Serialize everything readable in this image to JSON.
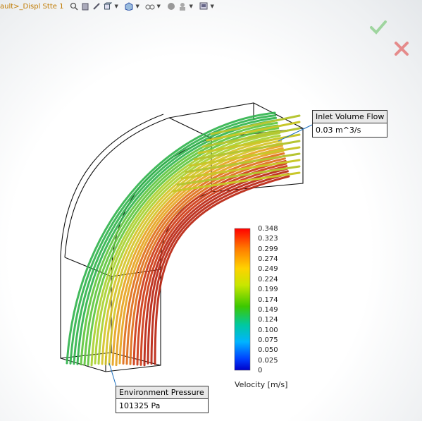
{
  "toolbar": {
    "config_label": "ault>_Displ",
    "config_label_tail": "Stte 1",
    "icons": [
      "search-icon",
      "part-icon",
      "edit-icon",
      "view-orientation-icon",
      "display-style-icon",
      "hide-show-icon",
      "appearance-icon",
      "scene-icon",
      "view-settings-icon"
    ]
  },
  "confirm": {
    "accept_icon": "checkmark-icon",
    "cancel_icon": "close-icon",
    "accept_color": "#8fcf8f",
    "cancel_color": "#e07a7a"
  },
  "callouts": {
    "inlet": {
      "title": "Inlet Volume Flow",
      "value": "0.03 m^3/s"
    },
    "outlet": {
      "title": "Environment Pressure",
      "value": "101325 Pa"
    }
  },
  "legend": {
    "title": "Velocity [m/s]",
    "ticks": [
      "0.348",
      "0.323",
      "0.299",
      "0.274",
      "0.249",
      "0.224",
      "0.199",
      "0.174",
      "0.149",
      "0.124",
      "0.100",
      "0.075",
      "0.050",
      "0.025",
      "0"
    ],
    "gradient": [
      "#ff0000",
      "#ff7a00",
      "#ffd200",
      "#c8e600",
      "#3cc800",
      "#00c8a0",
      "#00b4ff",
      "#0040ff",
      "#0000c8"
    ]
  }
}
